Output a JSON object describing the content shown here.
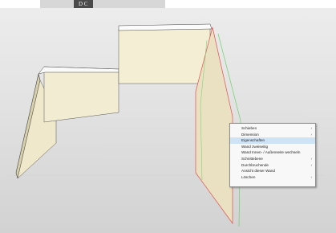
{
  "logo": {
    "text": "D C"
  },
  "context_menu": {
    "items": [
      {
        "label": "Schieben",
        "submenu": true
      },
      {
        "label": "Dimension",
        "submenu": true
      },
      {
        "label": "Eigenschaften",
        "submenu": false,
        "highlighted": true
      },
      {
        "label": "Wand zweiseitig",
        "submenu": false
      },
      {
        "label": "Wand Innen- / Außenseite wechseln",
        "submenu": false
      },
      {
        "label": "Schnittebene",
        "submenu": true
      },
      {
        "label": "Durchbruchende",
        "submenu": true
      },
      {
        "label": "Ansicht dieser Wand",
        "submenu": false
      },
      {
        "label": "Löschen",
        "submenu": true
      }
    ],
    "arrow_glyph": "›"
  },
  "colors": {
    "wall_face": "#eee7c8",
    "wall_dark": "#d9d0ad",
    "highlight_red": "#e05050",
    "highlight_green": "#6cd06c",
    "menu_highlight": "#cfe3f7"
  }
}
